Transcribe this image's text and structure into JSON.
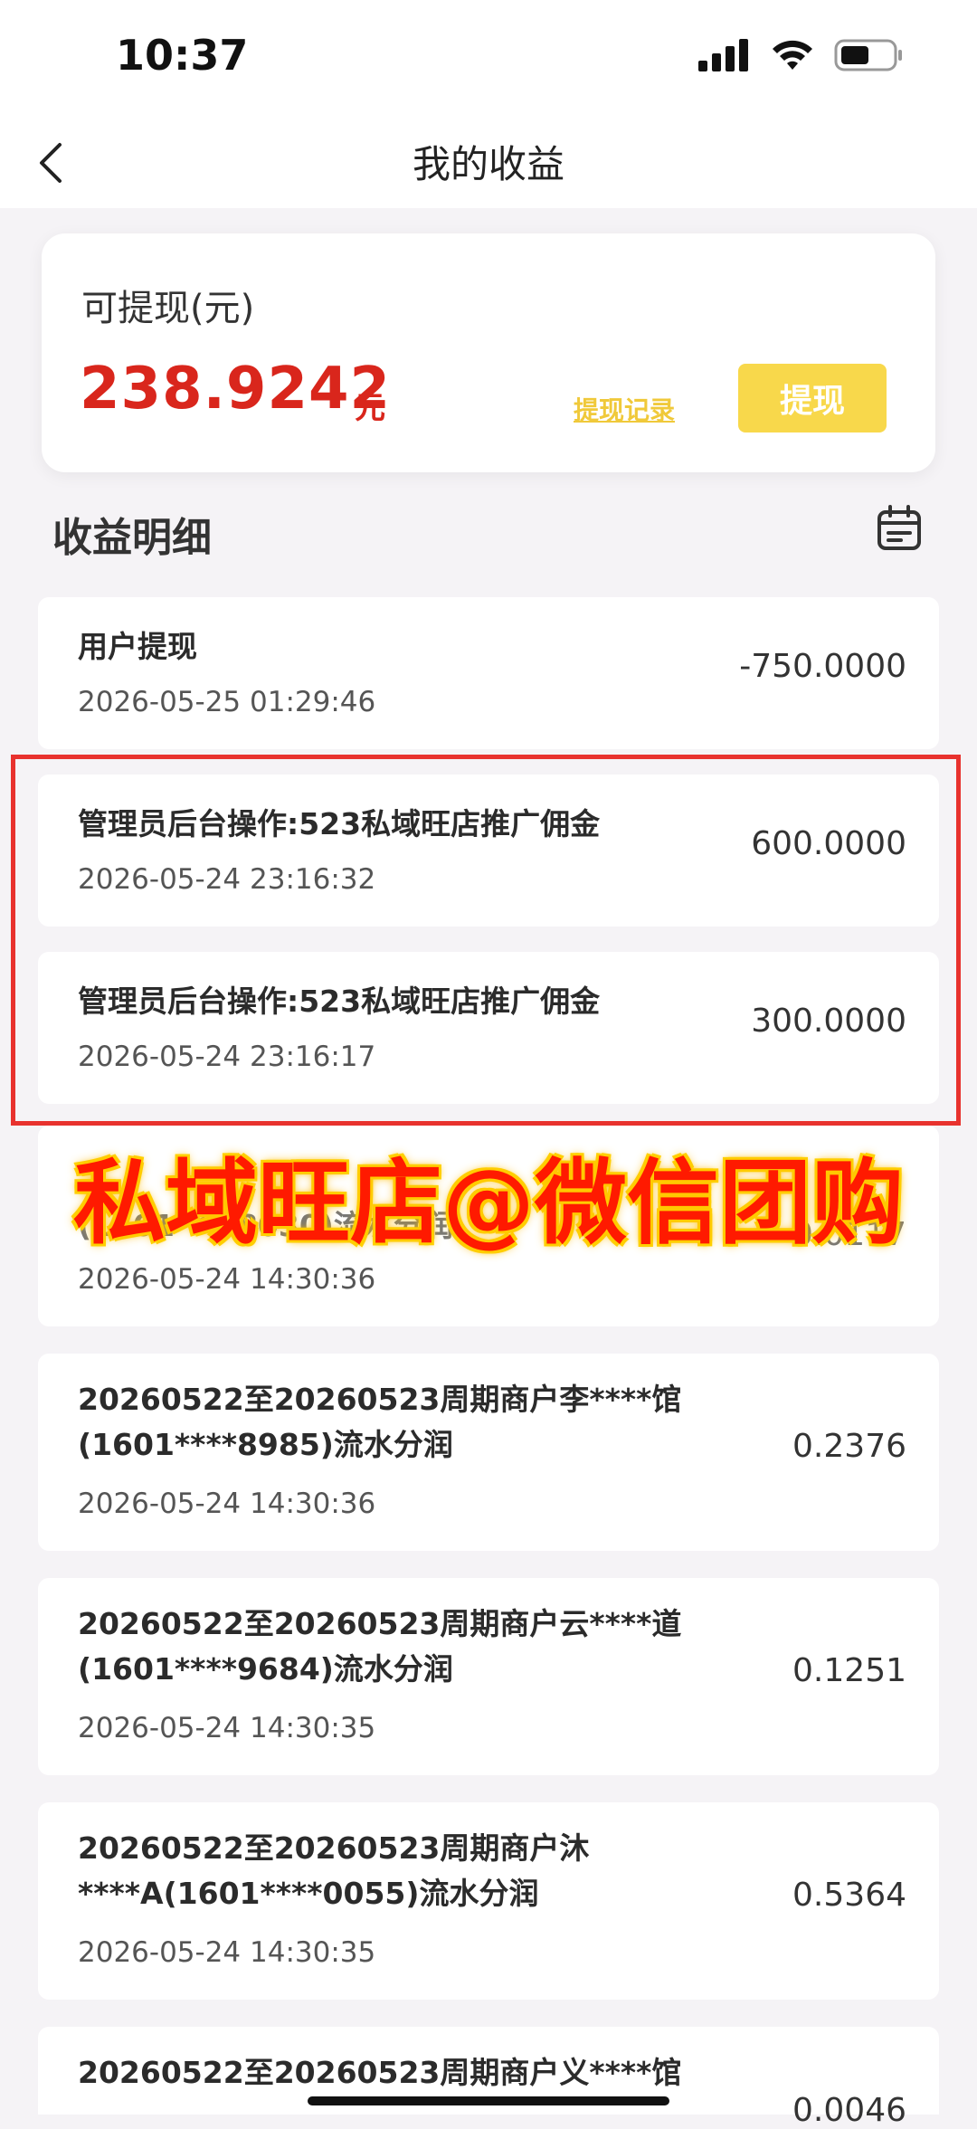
{
  "status": {
    "time": "10:37"
  },
  "nav": {
    "title": "我的收益",
    "back_icon": "chevron-left-icon"
  },
  "balance": {
    "label": "可提现(元)",
    "amount": "238.9242",
    "unit": "元",
    "record_link": "提现记录",
    "withdraw_button": "提现"
  },
  "section": {
    "title": "收益明细",
    "calendar_icon": "calendar-icon"
  },
  "records": [
    {
      "title": "用户提现",
      "time": "2026-05-25 01:29:46",
      "amount": "-750.0000"
    },
    {
      "title": "管理员后台操作:523私域旺店推广佣金",
      "time": "2026-05-24 23:16:32",
      "amount": "600.0000"
    },
    {
      "title": "管理员后台操作:523私域旺店推广佣金",
      "time": "2026-05-24 23:16:17",
      "amount": "300.0000"
    },
    {
      "title": "(1601****8030)流水分润",
      "time": "2026-05-24 14:30:36",
      "amount": "0.0117"
    },
    {
      "title": "20260522至20260523周期商户李****馆(1601****8985)流水分润",
      "time": "2026-05-24 14:30:36",
      "amount": "0.2376"
    },
    {
      "title": "20260522至20260523周期商户云****道(1601****9684)流水分润",
      "time": "2026-05-24 14:30:35",
      "amount": "0.1251"
    },
    {
      "title": "20260522至20260523周期商户沐****A(1601****0055)流水分润",
      "time": "2026-05-24 14:30:35",
      "amount": "0.5364"
    },
    {
      "title": "20260522至20260523周期商户义****馆",
      "time": "",
      "amount": "0.0046"
    }
  ],
  "watermark": "私域旺店@微信团购",
  "colors": {
    "accent_red": "#d9261c",
    "button_yellow": "#f8d84b",
    "highlight_red": "#e8322e"
  }
}
